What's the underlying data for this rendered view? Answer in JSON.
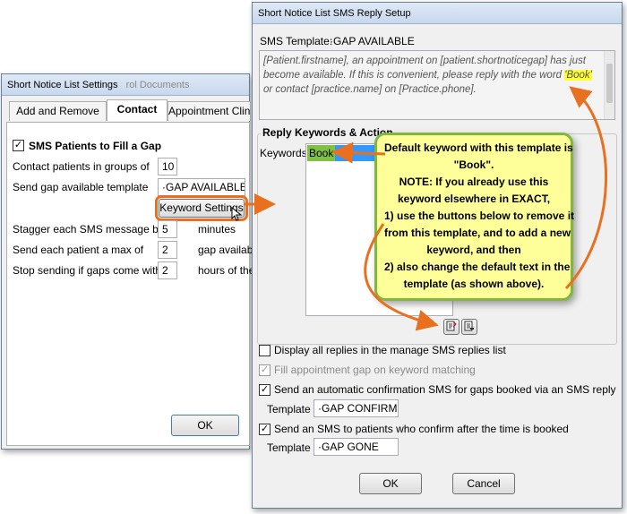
{
  "left_window": {
    "title": "Short Notice List Settings",
    "title_ghost": "rol Documents",
    "tabs": [
      "Add and Remove",
      "Contact",
      "Appointment Clinic"
    ],
    "sms_checkbox_label": "SMS Patients to Fill a Gap",
    "rows": {
      "groups_label": "Contact patients in groups of",
      "groups_value": "10",
      "template_label": "Send gap available template",
      "template_value": "·GAP AVAILABLE",
      "keyword_button": "Keyword Settings",
      "stagger_label": "Stagger each SMS message by",
      "stagger_value": "5",
      "stagger_unit": "minutes",
      "max_label": "Send each patient a max of",
      "max_value": "2",
      "max_unit": "gap availabl",
      "stop_label": "Stop sending if gaps come within",
      "stop_value": "2",
      "stop_unit": "hours of the"
    },
    "ok_button": "OK"
  },
  "right_window": {
    "title": "Short Notice List SMS Reply Setup",
    "sms_template_label": "SMS Template:",
    "sms_template_value": "·GAP AVAILABLE",
    "message_parts": {
      "a": "[Patient.firstname], an appointment on [patient.shortnoticegap] has just become available. If this is convenient, please reply with the word ",
      "keyword": "'Book'",
      "b": " or contact [practice.name] on [Practice.phone]."
    },
    "reply_heading": "Reply Keywords & Action",
    "keywords_label": "Keywords",
    "keyword_item": "Book",
    "display_all_label": "Display all replies in the manage SMS replies list",
    "fill_gap_label": "Fill appointment gap on keyword matching",
    "auto_confirm_label": "Send an automatic confirmation SMS for gaps booked via an SMS reply",
    "template_label": "Template",
    "confirm_template_value": "·GAP CONFIRMED",
    "after_time_label": "Send an SMS to patients who confirm after the time is booked",
    "gone_template_value": "·GAP GONE",
    "ok_button": "OK",
    "cancel_button": "Cancel"
  },
  "callout": {
    "lines": [
      "Default keyword with this template is",
      "\"Book\".",
      "NOTE: If you already use this",
      "keyword elsewhere in EXACT,",
      "1) use the buttons below to remove it",
      "from this template, and to add a new",
      "keyword, and then",
      "2) also change the default text in the",
      "template (as shown above)."
    ]
  },
  "colors": {
    "annotation_orange": "#e8701f",
    "callout_fill": "#ffff99",
    "callout_border": "#7fb742"
  }
}
